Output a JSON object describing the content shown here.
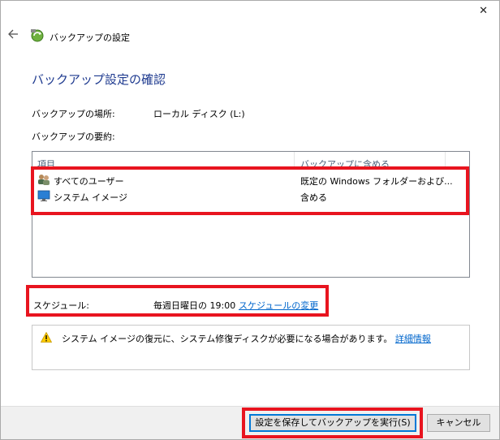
{
  "window": {
    "close_glyph": "✕",
    "title": "バックアップの設定"
  },
  "main": {
    "heading": "バックアップ設定の確認",
    "location_label": "バックアップの場所:",
    "location_value": "ローカル ディスク (L:)",
    "summary_label": "バックアップの要約:",
    "table": {
      "columns": [
        "項目",
        "バックアップに含める"
      ],
      "rows": [
        {
          "name": "すべてのユーザー",
          "value": "既定の Windows フォルダーおよび...",
          "icon": "users-icon"
        },
        {
          "name": "システム イメージ",
          "value": "含める",
          "icon": "monitor-icon"
        }
      ]
    },
    "schedule_label": "スケジュール:",
    "schedule_value": "毎週日曜日の 19:00",
    "schedule_link": "スケジュールの変更",
    "warning_text": "システム イメージの復元に、システム修復ディスクが必要になる場合があります。",
    "warning_link": "詳細情報",
    "warning_icon": "warning-icon"
  },
  "footer": {
    "save_run_button": "設定を保存してバックアップを実行(S)",
    "cancel_button": "キャンセル"
  },
  "colors": {
    "heading": "#1e3a8f",
    "link": "#0066cc",
    "highlight": "#e8141f"
  }
}
